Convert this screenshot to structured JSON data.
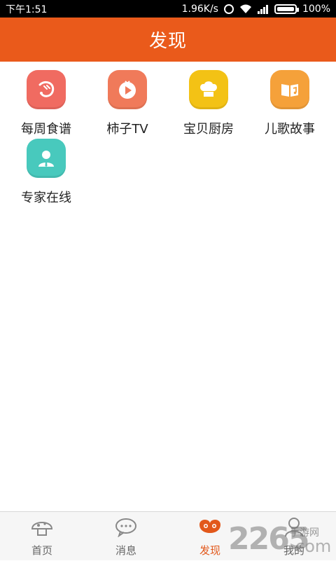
{
  "status_bar": {
    "time": "下午1:51",
    "network_speed": "1.96K/s",
    "battery": "100%",
    "icons": [
      "alarm-icon",
      "wifi-icon",
      "signal-icon",
      "battery-icon"
    ]
  },
  "header": {
    "title": "发现"
  },
  "grid": {
    "items": [
      {
        "label": "每周食谱",
        "icon": "shrimp-icon",
        "color": "#f06b61"
      },
      {
        "label": "柿子TV",
        "icon": "play-icon",
        "color": "#f07a5a"
      },
      {
        "label": "宝贝厨房",
        "icon": "chef-hat-icon",
        "color": "#f3c215"
      },
      {
        "label": "儿歌故事",
        "icon": "music-book-icon",
        "color": "#f5a13a"
      },
      {
        "label": "专家在线",
        "icon": "expert-icon",
        "color": "#48c9bd"
      }
    ]
  },
  "bottom_nav": {
    "items": [
      {
        "label": "首页",
        "icon": "home-icon",
        "active": false
      },
      {
        "label": "消息",
        "icon": "message-icon",
        "active": false
      },
      {
        "label": "发现",
        "icon": "discover-icon",
        "active": true
      },
      {
        "label": "我的",
        "icon": "profile-icon",
        "active": false
      }
    ]
  },
  "watermark": {
    "number": "2265",
    "text": "手游网",
    "suffix": "com"
  },
  "colors": {
    "accent": "#ea5a1b",
    "nav_active": "#e2581b",
    "text": "#222222"
  }
}
